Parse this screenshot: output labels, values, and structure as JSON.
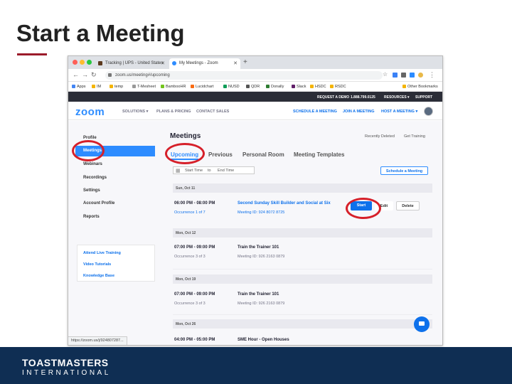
{
  "slide": {
    "title": "Start a Meeting",
    "accent_color": "#9b1b2a",
    "footer_brand": "TOASTMASTERS",
    "footer_sub": "INTERNATIONAL"
  },
  "browser": {
    "tabs": [
      {
        "label": "Tracking | UPS - United States",
        "icon": "ups-icon"
      },
      {
        "label": "My Meetings - Zoom",
        "icon": "zoom-tab-icon"
      }
    ],
    "url": "zoom.us/meeting#/upcoming",
    "bookmarks": [
      "Apps",
      "IM",
      "temp",
      "T-Mesheet",
      "BambooHR",
      "Lucidchart",
      "NUSD",
      "QDR",
      "Donally",
      "Slack",
      "HSDC",
      "RSDC"
    ],
    "other_bookmarks": "Other Bookmarks",
    "status_url": "https://zoom.us/j/924807287..."
  },
  "zoom": {
    "top_links": [
      "REQUEST A DEMO",
      "1.888.799.0125",
      "RESOURCES ▾",
      "SUPPORT"
    ],
    "logo": "zoom",
    "nav_left": [
      "SOLUTIONS ▾",
      "PLANS & PRICING",
      "CONTACT SALES"
    ],
    "nav_right": [
      "SCHEDULE A MEETING",
      "JOIN A MEETING",
      "HOST A MEETING ▾"
    ],
    "sidebar": [
      "Profile",
      "Meetings",
      "Webinars",
      "Recordings",
      "Settings",
      "Account Profile",
      "Reports"
    ],
    "sidebar_links": [
      "Attend Live Training",
      "Video Tutorials",
      "Knowledge Base"
    ],
    "page_title": "Meetings",
    "recently_deleted": "Recently Deleted",
    "get_training": "Get Training",
    "tabs": [
      "Upcoming",
      "Previous",
      "Personal Room",
      "Meeting Templates"
    ],
    "start_time": "Start Time",
    "to": "to",
    "end_time": "End Time",
    "schedule_button": "Schedule a Meeting",
    "days": [
      {
        "date": "Sun, Oct 11",
        "time": "06:00 PM - 08:00 PM",
        "occurrence": "Occurrence 1 of 7",
        "name": "Second Sunday Skill Builder and Social at Six",
        "id": "Meeting ID: 924 8072 8725"
      },
      {
        "date": "Mon, Oct 12",
        "time": "07:00 PM - 09:00 PM",
        "occurrence": "Occurrence 3 of 3",
        "name": "Train the Trainer 101",
        "id": "Meeting ID: 926 2163 0879"
      },
      {
        "date": "Mon, Oct 19",
        "time": "07:00 PM - 09:00 PM",
        "occurrence": "Occurrence 3 of 3",
        "name": "Train the Trainer 101",
        "id": "Meeting ID: 926 2163 0879"
      },
      {
        "date": "Mon, Oct 26",
        "time": "04:00 PM - 05:00 PM",
        "name": "SME Hour - Open Houses"
      }
    ],
    "actions": [
      "Start",
      "Edit",
      "Delete"
    ]
  }
}
